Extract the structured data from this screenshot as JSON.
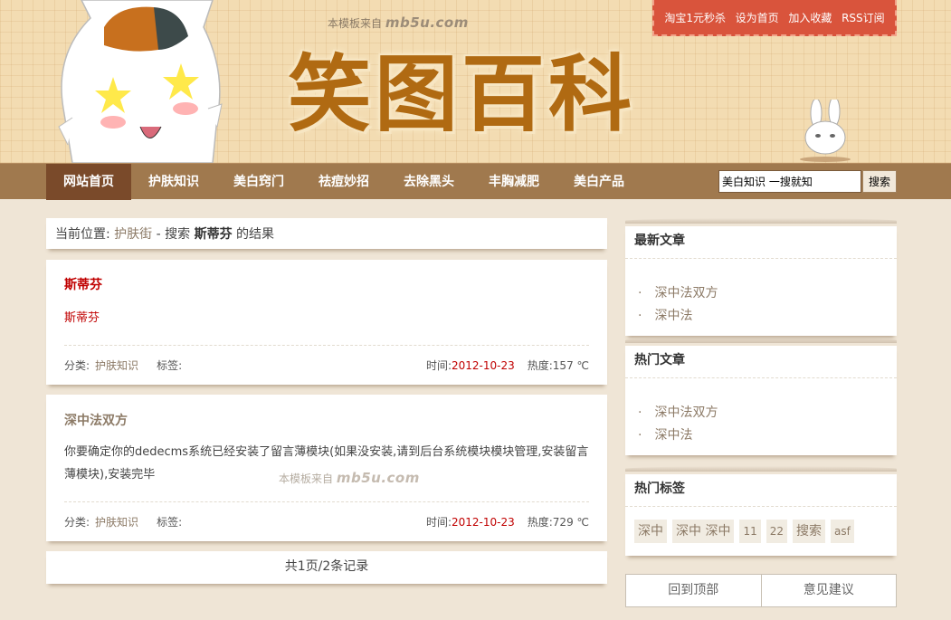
{
  "header": {
    "site_title": "笑图百科",
    "watermark": {
      "prefix": "本模板来自",
      "brand": "mb5u.com"
    },
    "toplinks": [
      "淘宝1元秒杀",
      "设为首页",
      "加入收藏",
      "RSS订阅"
    ]
  },
  "nav": {
    "items": [
      "网站首页",
      "护肤知识",
      "美白窍门",
      "祛痘妙招",
      "去除黑头",
      "丰胸减肥",
      "美白产品"
    ],
    "search_value": "美白知识 一搜就知",
    "search_button": "搜索"
  },
  "breadcrumb": {
    "prefix": "当前位置:",
    "link": "护肤街",
    "sep": " - 搜索 ",
    "keyword": "斯蒂芬",
    "suffix": " 的结果"
  },
  "articles": [
    {
      "title": "斯蒂芬",
      "body": "斯蒂芬",
      "category_label": "分类:",
      "category": "护肤知识",
      "tags_label": "标签:",
      "time_label": "时间:",
      "time": "2012-10-23",
      "heat_label": "热度:",
      "heat": "157 ℃"
    },
    {
      "title": "深中法双方",
      "body": "你要确定你的dedecms系统已经安装了留言薄模块(如果没安装,请到后台系统模块模块管理,安装留言薄模块),安装完毕",
      "category_label": "分类:",
      "category": "护肤知识",
      "tags_label": "标签:",
      "time_label": "时间:",
      "time": "2012-10-23",
      "heat_label": "热度:",
      "heat": "729 ℃"
    }
  ],
  "pager": "共1页/2条记录",
  "sidebar": {
    "latest": {
      "title": "最新文章",
      "items": [
        "深中法双方",
        "深中法"
      ]
    },
    "hot": {
      "title": "热门文章",
      "items": [
        "深中法双方",
        "深中法"
      ]
    },
    "tags": {
      "title": "热门标签",
      "items": [
        "深中",
        "深中 深中",
        "11",
        "22",
        "搜索",
        "asf"
      ]
    },
    "back_to_top": "回到顶部",
    "feedback": "意见建议"
  },
  "colors": {
    "accent": "#c00000",
    "nav": "#a0794e",
    "nav_active": "#7a4a2a",
    "title": "#b06a12",
    "toplinks": "#d9543c"
  }
}
